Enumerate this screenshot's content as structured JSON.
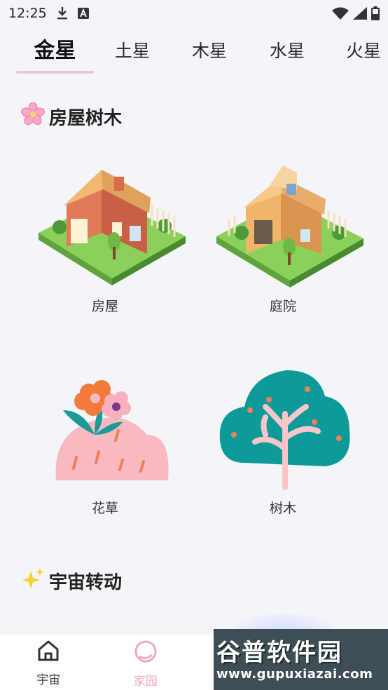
{
  "status_bar": {
    "time": "12:25",
    "icons": [
      "download-icon",
      "a-badge-icon",
      "wifi-icon",
      "signal-icon",
      "battery-icon"
    ]
  },
  "tabs": [
    {
      "label": "金星",
      "active": true
    },
    {
      "label": "土星",
      "active": false
    },
    {
      "label": "木星",
      "active": false
    },
    {
      "label": "水星",
      "active": false
    },
    {
      "label": "火星",
      "active": false
    }
  ],
  "sections": {
    "houses_trees": {
      "title": "房屋树木",
      "icon": "cherry-blossom-icon",
      "items": [
        {
          "label": "房屋",
          "icon": "house-icon"
        },
        {
          "label": "庭院",
          "icon": "yard-icon"
        },
        {
          "label": "花草",
          "icon": "flowers-icon"
        },
        {
          "label": "树木",
          "icon": "tree-icon"
        }
      ]
    },
    "universe_rotation": {
      "title": "宇宙转动",
      "icon": "sparkles-icon"
    }
  },
  "bottom_nav": [
    {
      "label": "宇宙",
      "icon": "home-icon"
    },
    {
      "label": "家园",
      "icon": "ring-icon"
    }
  ],
  "watermark": {
    "title": "谷普软件园",
    "url": "www.gupuxiazai.com"
  },
  "colors": {
    "background": "#f4f5f8",
    "tab_underline": "#efc7d4",
    "accent_pink": "#f2a9c0",
    "tree_teal": "#0f9a9a"
  }
}
